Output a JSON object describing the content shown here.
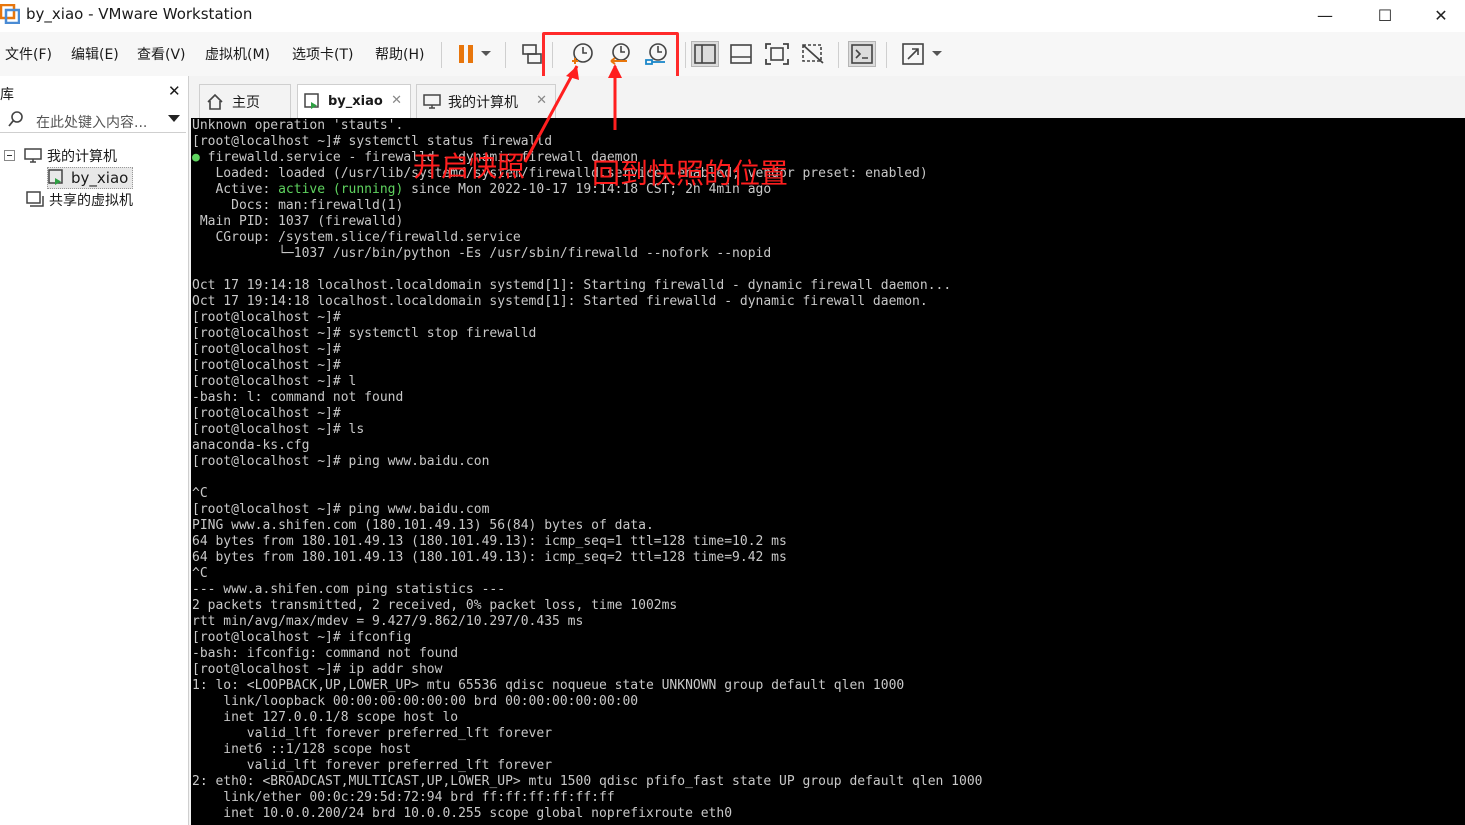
{
  "window": {
    "title": "by_xiao - VMware Workstation",
    "minimize": "—",
    "maximize": "☐",
    "close": "✕"
  },
  "menu": [
    "文件(F)",
    "编辑(E)",
    "查看(V)",
    "虚拟机(M)",
    "选项卡(T)",
    "帮助(H)"
  ],
  "toolbar": {
    "icons": [
      "pause-icon",
      "dropdown-arrow-icon",
      "send-ctrl-alt-del-icon",
      "take-snapshot-icon",
      "revert-snapshot-icon",
      "snapshot-manager-icon",
      "library-view-icon",
      "thumbnail-bar-icon",
      "fullscreen-icon",
      "unity-icon",
      "console-view-icon",
      "stretch-icon",
      "dropdown-arrow-icon"
    ]
  },
  "library": {
    "header": "库",
    "close": "✕",
    "search_placeholder": "在此处键入内容...",
    "tree": {
      "root": "我的计算机",
      "vm": "by_xiao",
      "shared": "共享的虚拟机"
    }
  },
  "tabs": [
    {
      "label": "主页",
      "icon": "home-icon",
      "active": false
    },
    {
      "label": "by_xiao",
      "icon": "vm-running-icon",
      "active": true
    },
    {
      "label": "我的计算机",
      "icon": "computer-icon",
      "active": false
    }
  ],
  "tab_close": "✕",
  "annotations": {
    "snapshot_label": "开启快照",
    "revert_label": "回到快照的位置"
  },
  "terminal": {
    "lines": [
      "Unknown operation 'stauts'.",
      "[root@localhost ~]# systemctl status firewalld",
      "● firewalld.service - firewalld - dynamic firewall daemon",
      "   Loaded: loaded (/usr/lib/systemd/system/firewalld.service; enabled; vendor preset: enabled)",
      "   Active: active (running) since Mon 2022-10-17 19:14:18 CST; 2h 4min ago",
      "     Docs: man:firewalld(1)",
      " Main PID: 1037 (firewalld)",
      "   CGroup: /system.slice/firewalld.service",
      "           └─1037 /usr/bin/python -Es /usr/sbin/firewalld --nofork --nopid",
      "",
      "Oct 17 19:14:18 localhost.localdomain systemd[1]: Starting firewalld - dynamic firewall daemon...",
      "Oct 17 19:14:18 localhost.localdomain systemd[1]: Started firewalld - dynamic firewall daemon.",
      "[root@localhost ~]#",
      "[root@localhost ~]# systemctl stop firewalld",
      "[root@localhost ~]#",
      "[root@localhost ~]#",
      "[root@localhost ~]# l",
      "-bash: l: command not found",
      "[root@localhost ~]#",
      "[root@localhost ~]# ls",
      "anaconda-ks.cfg",
      "[root@localhost ~]# ping www.baidu.con",
      "",
      "^C",
      "[root@localhost ~]# ping www.baidu.com",
      "PING www.a.shifen.com (180.101.49.13) 56(84) bytes of data.",
      "64 bytes from 180.101.49.13 (180.101.49.13): icmp_seq=1 ttl=128 time=10.2 ms",
      "64 bytes from 180.101.49.13 (180.101.49.13): icmp_seq=2 ttl=128 time=9.42 ms",
      "^C",
      "--- www.a.shifen.com ping statistics ---",
      "2 packets transmitted, 2 received, 0% packet loss, time 1002ms",
      "rtt min/avg/max/mdev = 9.427/9.862/10.297/0.435 ms",
      "[root@localhost ~]# ifconfig",
      "-bash: ifconfig: command not found",
      "[root@localhost ~]# ip addr show",
      "1: lo: <LOOPBACK,UP,LOWER_UP> mtu 65536 qdisc noqueue state UNKNOWN group default qlen 1000",
      "    link/loopback 00:00:00:00:00:00 brd 00:00:00:00:00:00",
      "    inet 127.0.0.1/8 scope host lo",
      "       valid_lft forever preferred_lft forever",
      "    inet6 ::1/128 scope host",
      "       valid_lft forever preferred_lft forever",
      "2: eth0: <BROADCAST,MULTICAST,UP,LOWER_UP> mtu 1500 qdisc pfifo_fast state UP group default qlen 1000",
      "    link/ether 00:0c:29:5d:72:94 brd ff:ff:ff:ff:ff:ff",
      "    inet 10.0.0.200/24 brd 10.0.0.255 scope global noprefixroute eth0"
    ],
    "highlight_green": "active (running)"
  },
  "colors": {
    "accent_orange": "#e8760c",
    "annotation_red": "#ff1e1e",
    "status_green": "#5fd35f"
  }
}
